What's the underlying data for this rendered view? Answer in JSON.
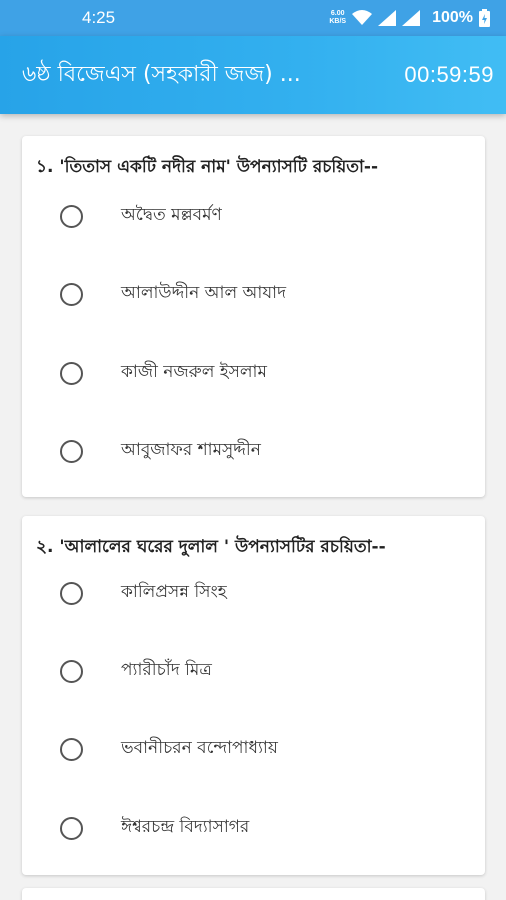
{
  "status_bar": {
    "time": "4:25",
    "net_speed_value": "6.00",
    "net_speed_unit": "KB/S",
    "battery": "100%"
  },
  "app_bar": {
    "title": "৬ষ্ঠ বিজেএস (সহকারী জজ) ...",
    "timer": "00:59:59"
  },
  "questions": [
    {
      "text": "১. 'তিতাস একটি নদীর নাম' উপন্যাসটি রচয়িতা--",
      "options": [
        "অদ্বৈত মল্লবর্মণ",
        "আলাউদ্দীন আল আযাদ",
        "কাজী নজরুল ইসলাম",
        "আবুজাফর শামসুদ্দীন"
      ]
    },
    {
      "text": "২. 'আলালের ঘরের দুলাল ' উপন্যাসটির রচয়িতা--",
      "options": [
        "কালিপ্রসন্ন সিংহ",
        "প্যারীচাঁদ মিত্র",
        "ভবানীচরন বন্দোপাধ্যায়",
        "ঈশ্বরচন্দ্র বিদ্যাসাগর"
      ]
    }
  ],
  "colors": {
    "status_bar": "#3fa2e6",
    "app_bar": "#33b0ef",
    "background": "#f2f2f2",
    "card": "#ffffff"
  }
}
